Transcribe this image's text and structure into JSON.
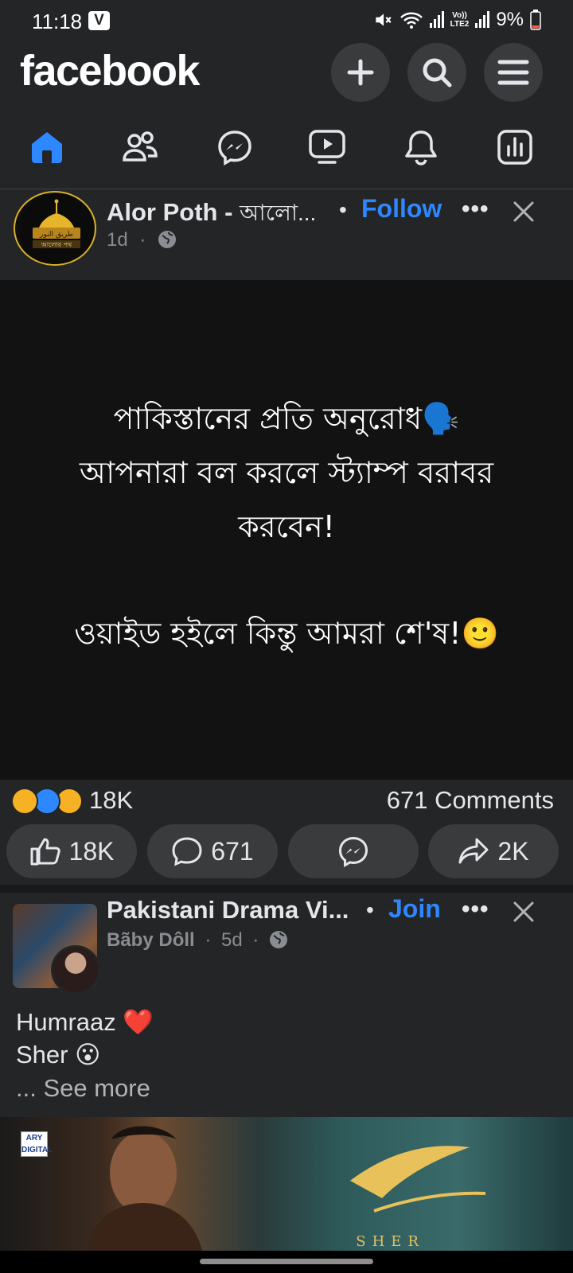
{
  "status_bar": {
    "time": "11:18",
    "badge": "V",
    "volte": "Vo))",
    "lte": "LTE2",
    "battery": "9%"
  },
  "header": {
    "logo": "facebook",
    "buttons": [
      "add-icon",
      "search-icon",
      "menu-icon"
    ]
  },
  "nav": {
    "tabs": [
      "home-icon",
      "friends-icon",
      "messenger-icon",
      "video-icon",
      "notifications-icon",
      "dashboard-icon"
    ],
    "active": "home"
  },
  "post1": {
    "page_name": "Alor Poth - ",
    "page_name_sub": "আলো...",
    "follow_dot": "•",
    "follow": "Follow",
    "time": "1d",
    "privacy_sep": "·",
    "more": "•••",
    "text_lines": [
      "পাকিস্তানের প্রতি অনুরোধ🗣️",
      "আপনারা বল করলে স্ট্যাম্প বরাবর",
      "করবেন!",
      "ওয়াইড হইলে কিন্তু আমরা শে'ষ!🙂"
    ],
    "reactions_count": "18K",
    "comments_count": "671 Comments",
    "actions": {
      "like": "18K",
      "comment": "671",
      "share": "2K"
    }
  },
  "post2": {
    "group_name": "Pakistani Drama Vi...",
    "join_dot": "•",
    "join": "Join",
    "author": "Bãby Dôll",
    "sep": "·",
    "time": "5d",
    "more": "•••",
    "line1": "Humraaz ❤️",
    "line2": "Sher 😮",
    "see_more": "... See more",
    "image_logo": "ARY DIGITAL",
    "image_title": "SHER"
  },
  "colors": {
    "background": "#242526",
    "accent": "#2d88ff",
    "button": "#3a3b3c",
    "post_body": "#121212"
  }
}
